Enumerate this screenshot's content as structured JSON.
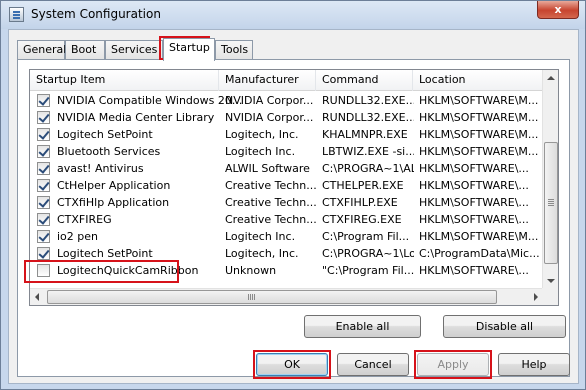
{
  "window": {
    "title": "System Configuration",
    "close_glyph": "x"
  },
  "tabs": [
    {
      "label": "General"
    },
    {
      "label": "Boot"
    },
    {
      "label": "Services"
    },
    {
      "label": "Startup"
    },
    {
      "label": "Tools"
    }
  ],
  "active_tab": "Startup",
  "columns": [
    "Startup Item",
    "Manufacturer",
    "Command",
    "Location"
  ],
  "rows": [
    {
      "checked": true,
      "item": "NVIDIA Compatible Windows 20...",
      "manufacturer": "NVIDIA Corpor...",
      "command": "RUNDLL32.EXE...",
      "location": "HKLM\\SOFTWARE\\M..."
    },
    {
      "checked": true,
      "item": "NVIDIA Media Center Library",
      "manufacturer": "NVIDIA Corpor...",
      "command": "RUNDLL32.EXE...",
      "location": "HKLM\\SOFTWARE\\M..."
    },
    {
      "checked": true,
      "item": "Logitech SetPoint",
      "manufacturer": "Logitech, Inc.",
      "command": "KHALMNPR.EXE",
      "location": "HKLM\\SOFTWARE\\M..."
    },
    {
      "checked": true,
      "item": "Bluetooth Services",
      "manufacturer": "Logitech Inc.",
      "command": "LBTWIZ.EXE -si...",
      "location": "HKLM\\SOFTWARE\\M..."
    },
    {
      "checked": true,
      "item": "avast! Antivirus",
      "manufacturer": "ALWIL Software",
      "command": "C:\\PROGRA~1\\AL...",
      "location": "HKLM\\SOFTWARE\\..."
    },
    {
      "checked": true,
      "item": "CtHelper Application",
      "manufacturer": "Creative Techn...",
      "command": "CTHELPER.EXE",
      "location": "HKLM\\SOFTWARE\\..."
    },
    {
      "checked": true,
      "item": "CTXfiHlp Application",
      "manufacturer": "Creative Techn...",
      "command": "CTXFIHLP.EXE",
      "location": "HKLM\\SOFTWARE\\..."
    },
    {
      "checked": true,
      "item": "CTXFIREG",
      "manufacturer": "Creative Techn...",
      "command": "CTXFIREG.EXE",
      "location": "HKLM\\SOFTWARE\\..."
    },
    {
      "checked": true,
      "item": "io2 pen",
      "manufacturer": "Logitech Inc.",
      "command": "C:\\Program Fil...",
      "location": "HKLM\\SOFTWARE\\M..."
    },
    {
      "checked": true,
      "item": "Logitech SetPoint",
      "manufacturer": "Logitech, Inc.",
      "command": "C:\\PROGRA~1\\Lo...",
      "location": "C:\\ProgramData\\Mic..."
    },
    {
      "checked": false,
      "item": "LogitechQuickCamRibbon",
      "manufacturer": "Unknown",
      "command": "\"C:\\Program Fil...",
      "location": "HKLM\\SOFTWARE\\..."
    }
  ],
  "buttons": {
    "enable_all": "Enable all",
    "disable_all": "Disable all",
    "ok": "OK",
    "cancel": "Cancel",
    "apply": "Apply",
    "help": "Help"
  },
  "colors": {
    "highlight": "#d6121a",
    "default_button_border": "#3c7fb1"
  }
}
